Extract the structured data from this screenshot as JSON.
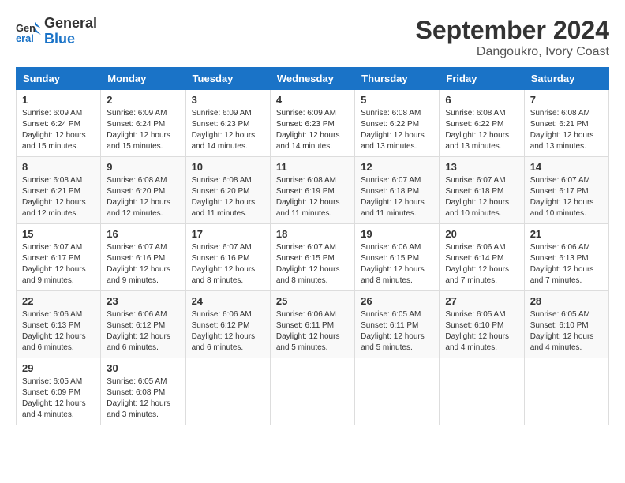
{
  "header": {
    "logo_line1": "General",
    "logo_line2": "Blue",
    "title": "September 2024",
    "subtitle": "Dangoukro, Ivory Coast"
  },
  "calendar": {
    "days_of_week": [
      "Sunday",
      "Monday",
      "Tuesday",
      "Wednesday",
      "Thursday",
      "Friday",
      "Saturday"
    ],
    "weeks": [
      [
        null,
        null,
        null,
        null,
        null,
        null,
        null
      ],
      [
        null,
        null,
        null,
        null,
        null,
        null,
        null
      ],
      [
        null,
        null,
        null,
        null,
        null,
        null,
        null
      ],
      [
        null,
        null,
        null,
        null,
        null,
        null,
        null
      ],
      [
        null,
        null,
        null,
        null,
        null,
        null,
        null
      ],
      [
        null,
        null,
        null,
        null,
        null,
        null,
        null
      ]
    ],
    "cells": [
      {
        "week": 0,
        "day_of_week": 0,
        "date": "1",
        "sunrise": "6:09 AM",
        "sunset": "6:24 PM",
        "daylight": "12 hours and 15 minutes."
      },
      {
        "week": 0,
        "day_of_week": 1,
        "date": "2",
        "sunrise": "6:09 AM",
        "sunset": "6:24 PM",
        "daylight": "12 hours and 15 minutes."
      },
      {
        "week": 0,
        "day_of_week": 2,
        "date": "3",
        "sunrise": "6:09 AM",
        "sunset": "6:23 PM",
        "daylight": "12 hours and 14 minutes."
      },
      {
        "week": 0,
        "day_of_week": 3,
        "date": "4",
        "sunrise": "6:09 AM",
        "sunset": "6:23 PM",
        "daylight": "12 hours and 14 minutes."
      },
      {
        "week": 0,
        "day_of_week": 4,
        "date": "5",
        "sunrise": "6:08 AM",
        "sunset": "6:22 PM",
        "daylight": "12 hours and 13 minutes."
      },
      {
        "week": 0,
        "day_of_week": 5,
        "date": "6",
        "sunrise": "6:08 AM",
        "sunset": "6:22 PM",
        "daylight": "12 hours and 13 minutes."
      },
      {
        "week": 0,
        "day_of_week": 6,
        "date": "7",
        "sunrise": "6:08 AM",
        "sunset": "6:21 PM",
        "daylight": "12 hours and 13 minutes."
      },
      {
        "week": 1,
        "day_of_week": 0,
        "date": "8",
        "sunrise": "6:08 AM",
        "sunset": "6:21 PM",
        "daylight": "12 hours and 12 minutes."
      },
      {
        "week": 1,
        "day_of_week": 1,
        "date": "9",
        "sunrise": "6:08 AM",
        "sunset": "6:20 PM",
        "daylight": "12 hours and 12 minutes."
      },
      {
        "week": 1,
        "day_of_week": 2,
        "date": "10",
        "sunrise": "6:08 AM",
        "sunset": "6:20 PM",
        "daylight": "12 hours and 11 minutes."
      },
      {
        "week": 1,
        "day_of_week": 3,
        "date": "11",
        "sunrise": "6:08 AM",
        "sunset": "6:19 PM",
        "daylight": "12 hours and 11 minutes."
      },
      {
        "week": 1,
        "day_of_week": 4,
        "date": "12",
        "sunrise": "6:07 AM",
        "sunset": "6:18 PM",
        "daylight": "12 hours and 11 minutes."
      },
      {
        "week": 1,
        "day_of_week": 5,
        "date": "13",
        "sunrise": "6:07 AM",
        "sunset": "6:18 PM",
        "daylight": "12 hours and 10 minutes."
      },
      {
        "week": 1,
        "day_of_week": 6,
        "date": "14",
        "sunrise": "6:07 AM",
        "sunset": "6:17 PM",
        "daylight": "12 hours and 10 minutes."
      },
      {
        "week": 2,
        "day_of_week": 0,
        "date": "15",
        "sunrise": "6:07 AM",
        "sunset": "6:17 PM",
        "daylight": "12 hours and 9 minutes."
      },
      {
        "week": 2,
        "day_of_week": 1,
        "date": "16",
        "sunrise": "6:07 AM",
        "sunset": "6:16 PM",
        "daylight": "12 hours and 9 minutes."
      },
      {
        "week": 2,
        "day_of_week": 2,
        "date": "17",
        "sunrise": "6:07 AM",
        "sunset": "6:16 PM",
        "daylight": "12 hours and 8 minutes."
      },
      {
        "week": 2,
        "day_of_week": 3,
        "date": "18",
        "sunrise": "6:07 AM",
        "sunset": "6:15 PM",
        "daylight": "12 hours and 8 minutes."
      },
      {
        "week": 2,
        "day_of_week": 4,
        "date": "19",
        "sunrise": "6:06 AM",
        "sunset": "6:15 PM",
        "daylight": "12 hours and 8 minutes."
      },
      {
        "week": 2,
        "day_of_week": 5,
        "date": "20",
        "sunrise": "6:06 AM",
        "sunset": "6:14 PM",
        "daylight": "12 hours and 7 minutes."
      },
      {
        "week": 2,
        "day_of_week": 6,
        "date": "21",
        "sunrise": "6:06 AM",
        "sunset": "6:13 PM",
        "daylight": "12 hours and 7 minutes."
      },
      {
        "week": 3,
        "day_of_week": 0,
        "date": "22",
        "sunrise": "6:06 AM",
        "sunset": "6:13 PM",
        "daylight": "12 hours and 6 minutes."
      },
      {
        "week": 3,
        "day_of_week": 1,
        "date": "23",
        "sunrise": "6:06 AM",
        "sunset": "6:12 PM",
        "daylight": "12 hours and 6 minutes."
      },
      {
        "week": 3,
        "day_of_week": 2,
        "date": "24",
        "sunrise": "6:06 AM",
        "sunset": "6:12 PM",
        "daylight": "12 hours and 6 minutes."
      },
      {
        "week": 3,
        "day_of_week": 3,
        "date": "25",
        "sunrise": "6:06 AM",
        "sunset": "6:11 PM",
        "daylight": "12 hours and 5 minutes."
      },
      {
        "week": 3,
        "day_of_week": 4,
        "date": "26",
        "sunrise": "6:05 AM",
        "sunset": "6:11 PM",
        "daylight": "12 hours and 5 minutes."
      },
      {
        "week": 3,
        "day_of_week": 5,
        "date": "27",
        "sunrise": "6:05 AM",
        "sunset": "6:10 PM",
        "daylight": "12 hours and 4 minutes."
      },
      {
        "week": 3,
        "day_of_week": 6,
        "date": "28",
        "sunrise": "6:05 AM",
        "sunset": "6:10 PM",
        "daylight": "12 hours and 4 minutes."
      },
      {
        "week": 4,
        "day_of_week": 0,
        "date": "29",
        "sunrise": "6:05 AM",
        "sunset": "6:09 PM",
        "daylight": "12 hours and 4 minutes."
      },
      {
        "week": 4,
        "day_of_week": 1,
        "date": "30",
        "sunrise": "6:05 AM",
        "sunset": "6:08 PM",
        "daylight": "12 hours and 3 minutes."
      }
    ]
  }
}
